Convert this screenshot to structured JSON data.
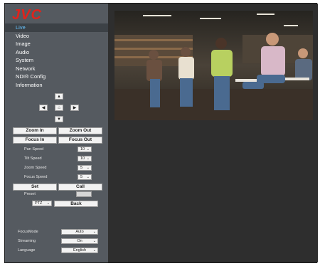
{
  "brand": {
    "logo_text": "JVC",
    "logo_color": "#e0231c"
  },
  "menu": [
    {
      "label": "Live",
      "active": true
    },
    {
      "label": "Video"
    },
    {
      "label": "Image"
    },
    {
      "label": "Audio"
    },
    {
      "label": "System"
    },
    {
      "label": "Network"
    },
    {
      "label": "NDI® Config"
    },
    {
      "label": "Information"
    }
  ],
  "ptz": {
    "zoom_in": "Zoom In",
    "zoom_out": "Zoom Out",
    "focus_in": "Focus In",
    "focus_out": "Focus Out",
    "pan_speed_label": "Pan Speed",
    "pan_speed": "10",
    "tilt_speed_label": "Tilt Speed",
    "tilt_speed": "10",
    "zoom_speed_label": "Zoom Speed",
    "zoom_speed": "5",
    "focus_speed_label": "Focus Speed",
    "focus_speed": "5",
    "set": "Set",
    "call": "Call",
    "preset_label": "Preset",
    "mode_value": "PTZ",
    "back": "Back"
  },
  "settings": {
    "focus_mode_label": "FocusMode",
    "focus_mode": "Auto",
    "streaming_label": "Streaming",
    "streaming": "On",
    "language_label": "Language",
    "language": "English"
  },
  "colors": {
    "sidebar": "#555a60",
    "active_text": "#66c4ff",
    "main_bg": "#2e2e2e"
  }
}
